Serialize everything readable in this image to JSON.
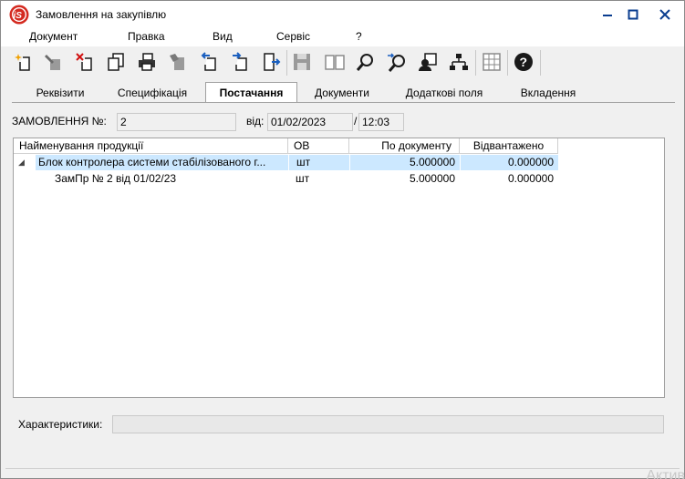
{
  "window": {
    "title": "Замовлення на закупівлю"
  },
  "menu": [
    "Документ",
    "Правка",
    "Вид",
    "Сервіс",
    "?"
  ],
  "toolbar_icons": [
    "new-doc-icon",
    "edit-doc-icon",
    "delete-doc-icon",
    "copy-doc-icon",
    "print-icon",
    "erase-icon",
    "import-icon",
    "export-icon",
    "move-icon",
    "save-icon",
    "open-book-icon",
    "find-icon",
    "find-next-icon",
    "user-card-icon",
    "hierarchy-icon",
    "table-icon",
    "help-icon"
  ],
  "tabs": [
    "Реквізити",
    "Специфікація",
    "Постачання",
    "Документи",
    "Додаткові поля",
    "Вкладення"
  ],
  "active_tab": "Постачання",
  "order": {
    "label": "ЗАМОВЛЕННЯ №:",
    "number": "2",
    "date_label": "від:",
    "date": "01/02/2023",
    "separator": "/",
    "time": "12:03"
  },
  "grid": {
    "columns": [
      "Найменування продукції",
      "ОВ",
      "По документу",
      "Відвантажено"
    ],
    "rows": [
      {
        "name": "Блок контролера системи стабілізованого г...",
        "unit": "шт",
        "by_doc": "5.000000",
        "shipped": "0.000000",
        "expander": "◢"
      },
      {
        "name": "ЗамПр № 2 від 01/02/23",
        "unit": "шт",
        "by_doc": "5.000000",
        "shipped": "0.000000"
      }
    ]
  },
  "characteristics": {
    "label": "Характеристики:",
    "value": ""
  },
  "watermark": "Актив"
}
